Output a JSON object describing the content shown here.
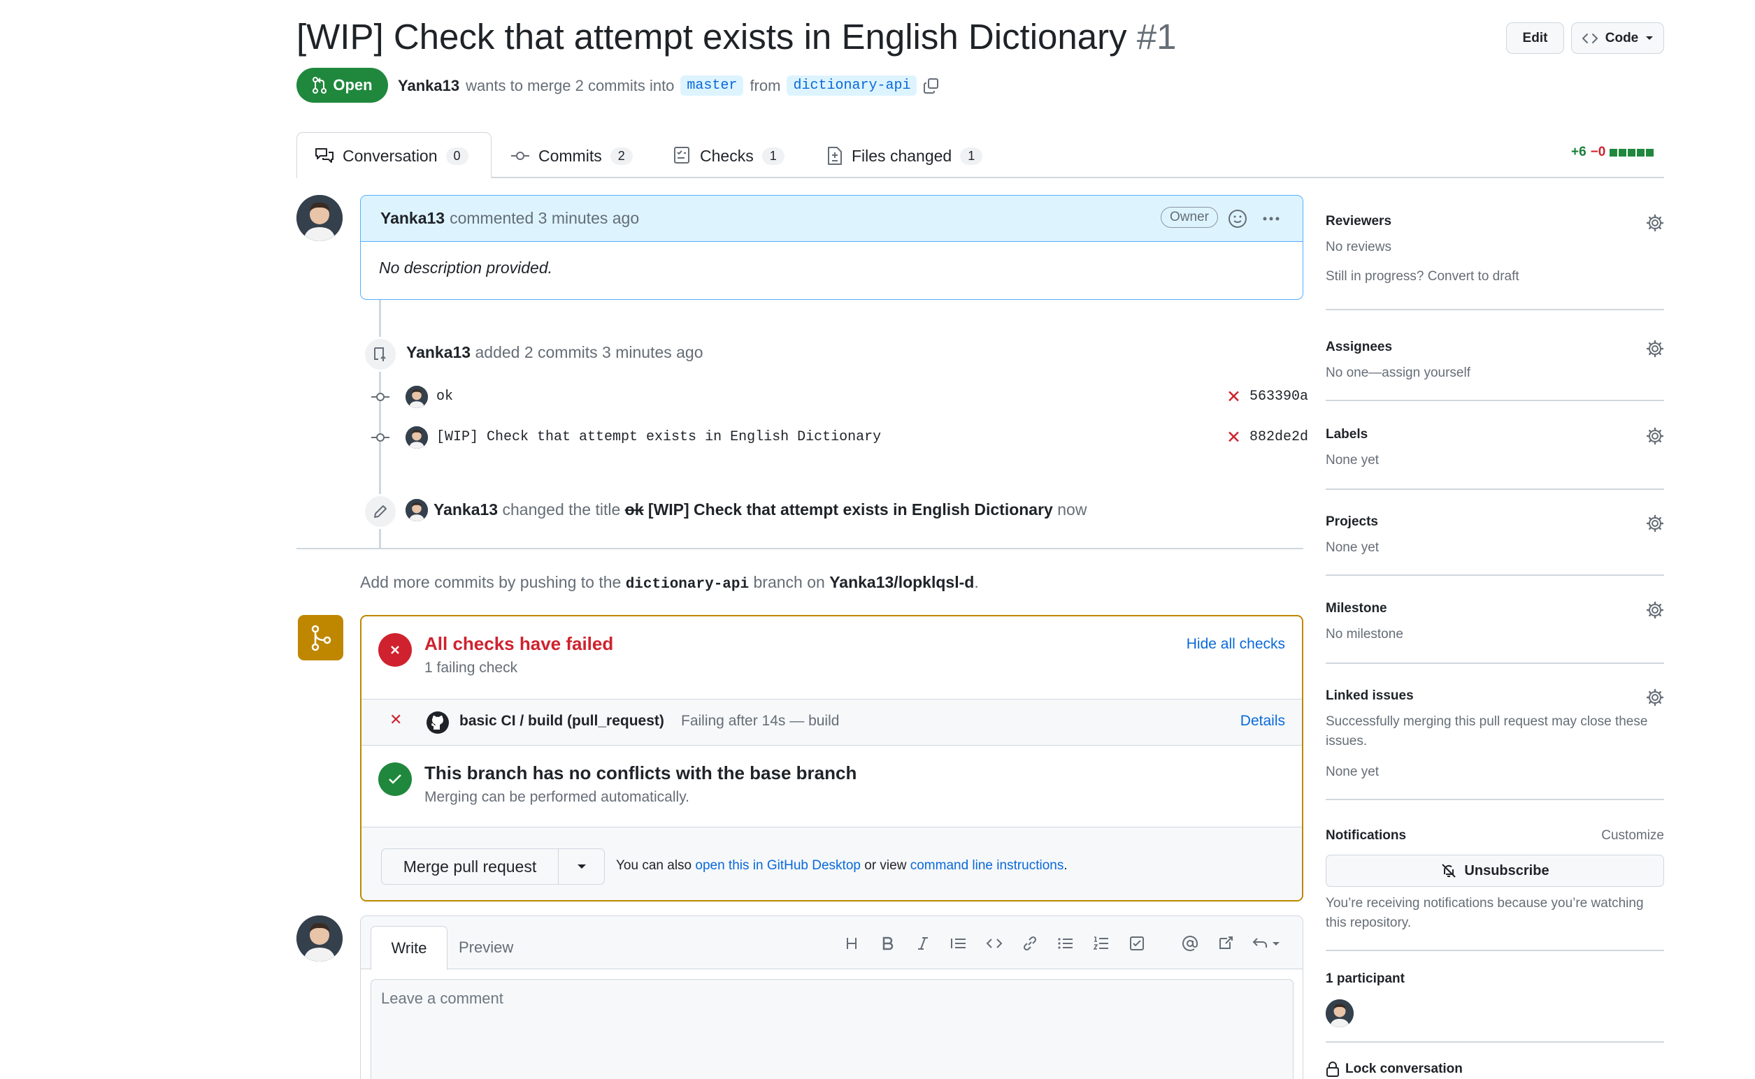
{
  "pr": {
    "title": "[WIP] Check that attempt exists in English Dictionary",
    "number": "#1",
    "edit_label": "Edit",
    "code_label": "Code",
    "state": "Open",
    "author": "Yanka13",
    "merge_text_1": "wants to merge 2 commits into",
    "base_branch": "master",
    "merge_text_2": "from",
    "head_branch": "dictionary-api"
  },
  "tabs": [
    {
      "label": "Conversation",
      "count": "0"
    },
    {
      "label": "Commits",
      "count": "2"
    },
    {
      "label": "Checks",
      "count": "1"
    },
    {
      "label": "Files changed",
      "count": "1"
    }
  ],
  "diffstat": {
    "additions": "+6",
    "deletions": "−0"
  },
  "comment": {
    "author": "Yanka13",
    "meta": "commented 3 minutes ago",
    "role": "Owner",
    "body": "No description provided."
  },
  "timeline": {
    "commits_author": "Yanka13",
    "commits_text": "added 2 commits 3 minutes ago",
    "commits": [
      {
        "message": "ok",
        "sha": "563390a"
      },
      {
        "message": "[WIP] Check that attempt exists in English Dictionary",
        "sha": "882de2d"
      }
    ],
    "rename_author": "Yanka13",
    "rename_text": "changed the title",
    "old_title": "ok",
    "new_title": "[WIP] Check that attempt exists in English Dictionary",
    "rename_time": "now"
  },
  "add_more": {
    "prefix": "Add more commits by pushing to the",
    "branch": "dictionary-api",
    "middle": "branch on",
    "repo": "Yanka13/lopklqsl-d",
    "suffix": "."
  },
  "merge_box": {
    "checks_title": "All checks have failed",
    "checks_sub": "1 failing check",
    "hide_checks": "Hide all checks",
    "check_name": "basic CI / build (pull_request)",
    "check_status": "Failing after 14s — build",
    "details": "Details",
    "conflict_title": "This branch has no conflicts with the base branch",
    "conflict_sub": "Merging can be performed automatically.",
    "merge_button": "Merge pull request",
    "also_text": "You can also",
    "desktop_link": "open this in GitHub Desktop",
    "or_view": "or view",
    "cli_link": "command line instructions",
    "period": "."
  },
  "editor": {
    "write_tab": "Write",
    "preview_tab": "Preview",
    "placeholder": "Leave a comment"
  },
  "sidebar": {
    "reviewers": {
      "heading": "Reviewers",
      "value": "No reviews",
      "extra": "Still in progress? Convert to draft"
    },
    "assignees": {
      "heading": "Assignees",
      "value": "No one—assign yourself"
    },
    "labels": {
      "heading": "Labels",
      "value": "None yet"
    },
    "projects": {
      "heading": "Projects",
      "value": "None yet"
    },
    "milestone": {
      "heading": "Milestone",
      "value": "No milestone"
    },
    "linked_issues": {
      "heading": "Linked issues",
      "description": "Successfully merging this pull request may close these issues.",
      "value": "None yet"
    },
    "notifications": {
      "heading": "Notifications",
      "customize": "Customize",
      "button": "Unsubscribe",
      "reason": "You’re receiving notifications because you’re watching this repository."
    },
    "participants": {
      "heading": "1 participant"
    },
    "lock": "Lock conversation"
  },
  "colors": {
    "accent": "#0969da",
    "open": "#1f883d",
    "danger": "#cf222e",
    "attention": "#bf8700"
  }
}
